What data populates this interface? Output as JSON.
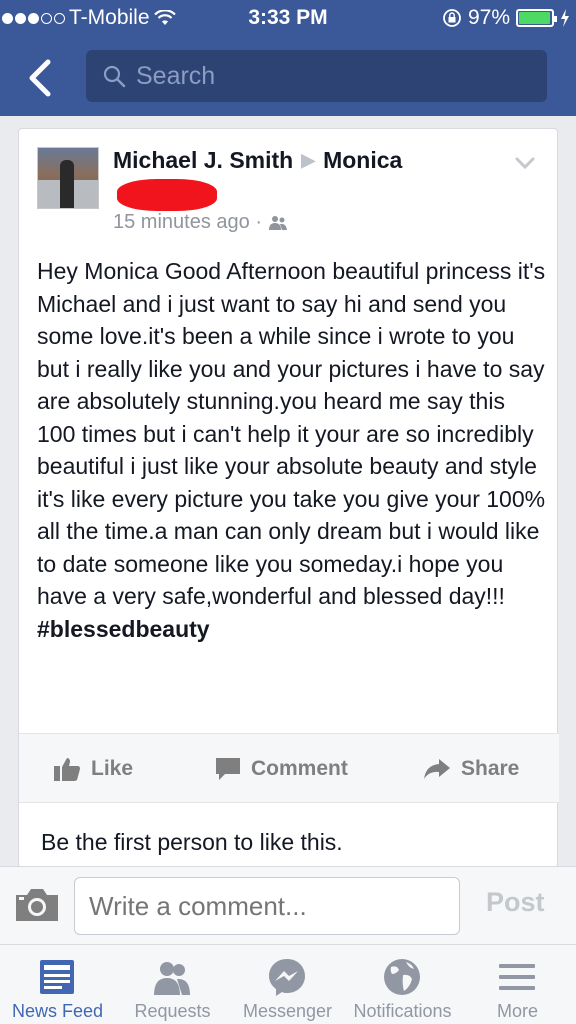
{
  "status_bar": {
    "carrier": "T-Mobile",
    "time": "3:33 PM",
    "battery": "97%",
    "battery_level": 0.97
  },
  "nav": {
    "search_placeholder": "Search"
  },
  "post": {
    "author": "Michael J. Smith",
    "recipient": "Monica",
    "time_ago": "15 minutes ago ·",
    "body": "Hey Monica Good Afternoon beautiful princess it's Michael and i just want to say hi and send you some love.it's been a while since i wrote to you but i really like you and your pictures i have to say are absolutely stunning.you heard me say this 100 times but i can't help it your are so incredibly beautiful i just like your absolute beauty and style it's like every picture you take you give your 100% all the time.a man can only dream but i would like to date someone like you someday.i hope you have a very safe,wonderful and blessed day!!!",
    "hashtag": "#blessedbeauty",
    "actions": {
      "like": "Like",
      "comment": "Comment",
      "share": "Share"
    },
    "likes_text": "Be the first person to like this."
  },
  "comment_bar": {
    "placeholder": "Write a comment...",
    "post_label": "Post"
  },
  "tabs": [
    {
      "label": "News Feed",
      "icon": "news-feed-icon",
      "active": true
    },
    {
      "label": "Requests",
      "icon": "requests-icon",
      "active": false
    },
    {
      "label": "Messenger",
      "icon": "messenger-icon",
      "active": false
    },
    {
      "label": "Notifications",
      "icon": "globe-icon",
      "active": false
    },
    {
      "label": "More",
      "icon": "menu-icon",
      "active": false
    }
  ],
  "colors": {
    "brand": "#3b5998",
    "active_tab": "#4267b2",
    "battery": "#4cd964",
    "redaction": "#f2141c"
  }
}
